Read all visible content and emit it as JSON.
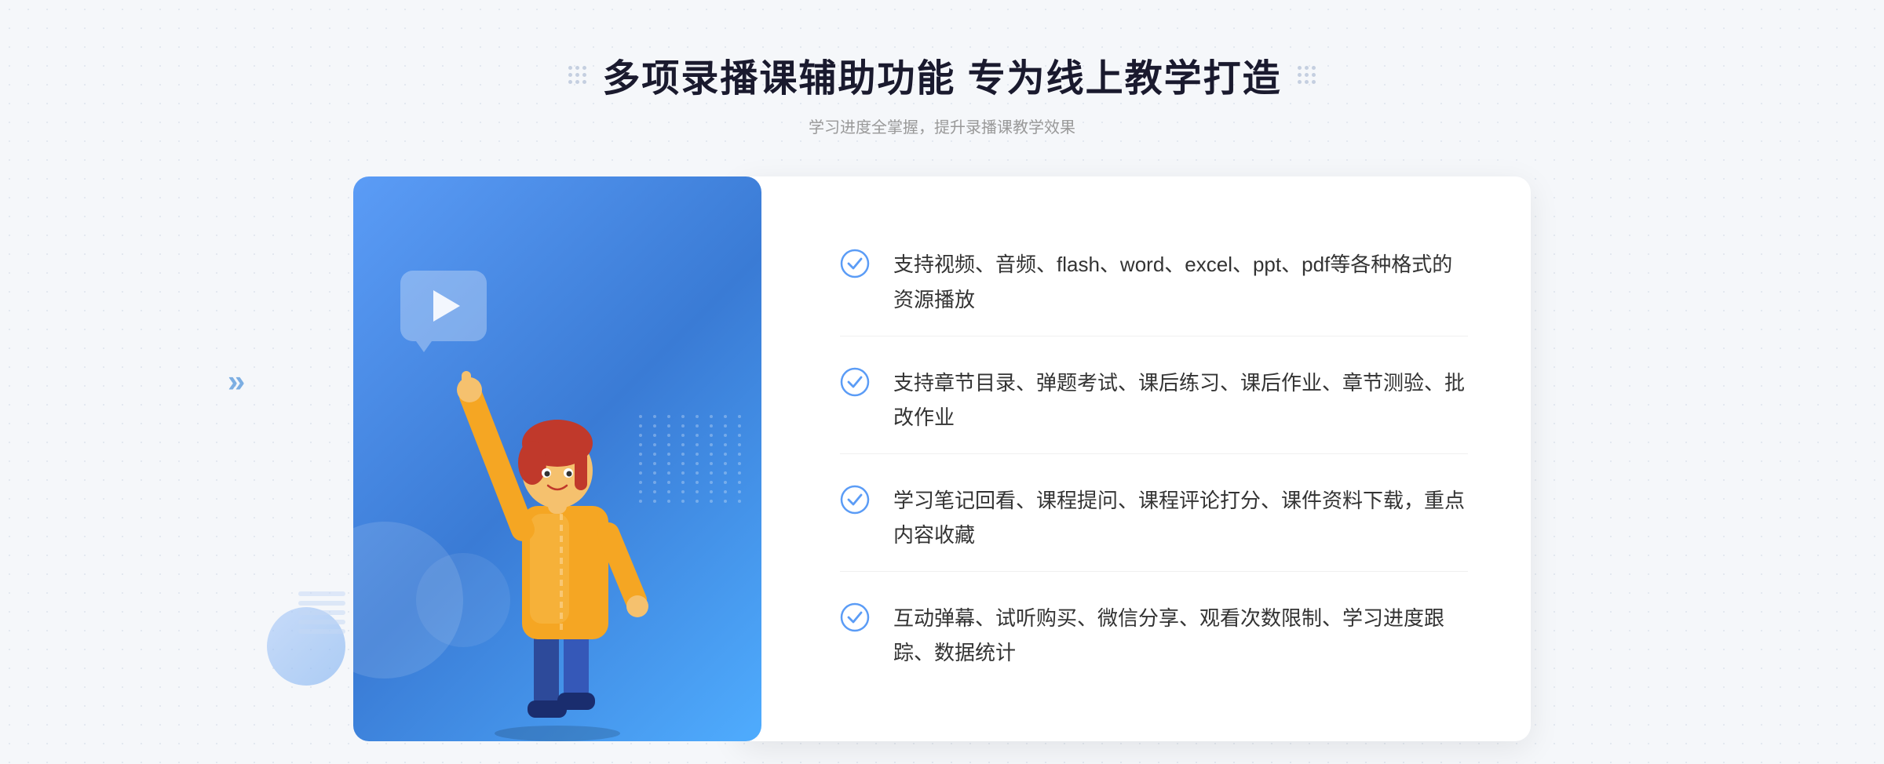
{
  "header": {
    "title": "多项录播课辅助功能 专为线上教学打造",
    "subtitle": "学习进度全掌握，提升录播课教学效果",
    "dots_label": "decorative-dots"
  },
  "features": [
    {
      "id": "feature-1",
      "text": "支持视频、音频、flash、word、excel、ppt、pdf等各种格式的资源播放"
    },
    {
      "id": "feature-2",
      "text": "支持章节目录、弹题考试、课后练习、课后作业、章节测验、批改作业"
    },
    {
      "id": "feature-3",
      "text": "学习笔记回看、课程提问、课程评论打分、课件资料下载，重点内容收藏"
    },
    {
      "id": "feature-4",
      "text": "互动弹幕、试听购买、微信分享、观看次数限制、学习进度跟踪、数据统计"
    }
  ],
  "colors": {
    "primary_blue": "#4a90e2",
    "gradient_start": "#5b9cf6",
    "gradient_end": "#3a7bd5",
    "text_dark": "#1a1a2e",
    "text_gray": "#999999",
    "text_feature": "#333333",
    "check_color": "#5b9cf6",
    "bg_color": "#f5f7fa"
  },
  "decoration": {
    "left_arrow": "»",
    "dots_unicode": "⠿"
  }
}
